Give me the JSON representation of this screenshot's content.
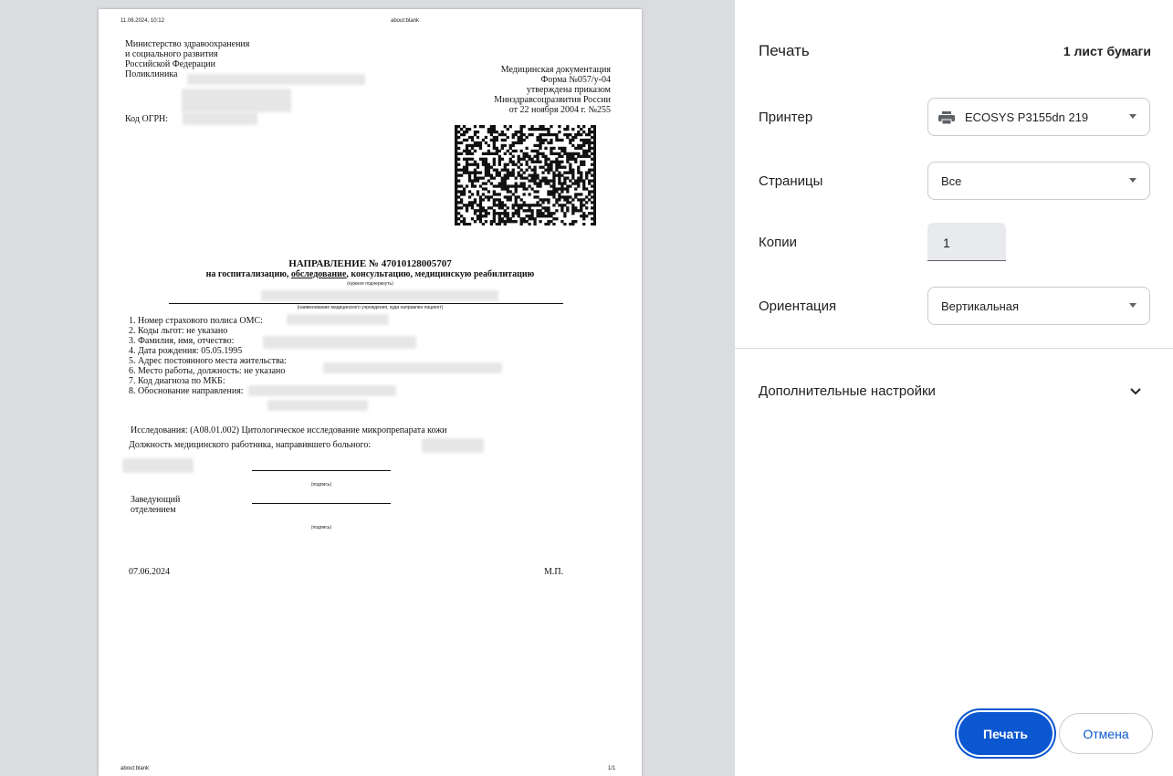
{
  "preview": {
    "header_datetime": "11.06.2024, 10:12",
    "header_url": "about:blank",
    "footer_url": "about:blank",
    "footer_pages": "1/1",
    "org_lines": [
      "Министерство здравоохранения",
      "и социального развития",
      "Российской Федерации",
      "Поликлиника"
    ],
    "ogrn_label": "Код ОГРН:",
    "form_lines": [
      "Медицинская документация",
      "Форма №057/у-04",
      "утверждена приказом",
      "Минздравсоцразвития России",
      "от 22 ноября 2004 г. №255"
    ],
    "title": "НАПРАВЛЕНИЕ № 47010128005707",
    "subtitle_prefix": "на госпитализацию, ",
    "subtitle_underlined": "обследование",
    "subtitle_suffix": ", консультацию, медицинскую реабилитацию",
    "subtitle_note": "(нужное подчеркнуть)",
    "institution_note": "(наименование медицинского учреждения, куда направлен пациент)",
    "fields": [
      "1. Номер страхового полиса ОМС:",
      "2. Коды льгот: не указано",
      "3. Фамилия, имя, отчество:",
      "4. Дата рождения: 05.05.1995",
      "5. Адрес постоянного места жительства:",
      "6. Место работы, должность: не указано",
      "7. Код диагноза по МКБ:",
      "8. Обоснование направления:"
    ],
    "research": "Исследования: (A08.01.002) Цитологическое исследование микропрепарата кожи",
    "doctor_position": "Должность медицинского работника, направившего больного:",
    "signature_note": "(подпись)",
    "head_label_1": "Заведующий",
    "head_label_2": "отделением",
    "date": "07.06.2024",
    "stamp": "М.П."
  },
  "settings": {
    "title": "Печать",
    "sheet_count": "1 лист бумаги",
    "printer_label": "Принтер",
    "printer_value": "ECOSYS P3155dn 219",
    "pages_label": "Страницы",
    "pages_value": "Все",
    "copies_label": "Копии",
    "copies_value": "1",
    "orientation_label": "Ориентация",
    "orientation_value": "Вертикальная",
    "more_settings": "Дополнительные настройки",
    "print_button": "Печать",
    "cancel_button": "Отмена"
  },
  "colors": {
    "accent": "#0b57d0",
    "preview_bg": "#dadce0"
  },
  "icons": {
    "printer": "printer-icon",
    "dropdown": "chevron-down-icon"
  }
}
